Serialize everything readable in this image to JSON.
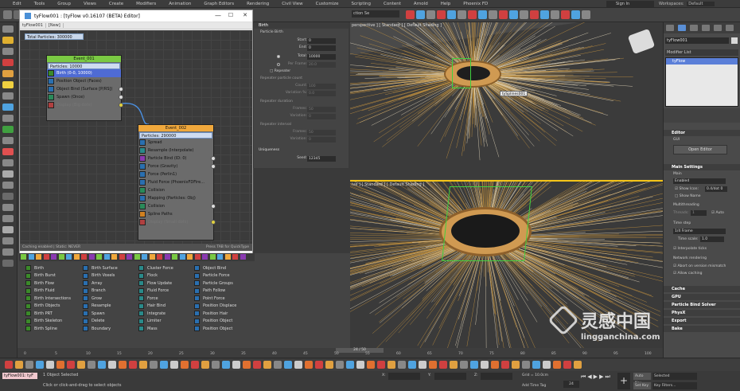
{
  "menu": [
    "Edit",
    "Tools",
    "Group",
    "Views",
    "Create",
    "Modifiers",
    "Animation",
    "Graph Editors",
    "Rendering",
    "Civil View",
    "Customize",
    "Scripting",
    "Content",
    "Arnold",
    "Help",
    "Phoenix FD"
  ],
  "topbar": {
    "sign_in": "Sign In",
    "workspaces_label": "Workspaces:",
    "workspaces_value": "Default",
    "selection_set": "ction Se"
  },
  "viewports": {
    "top_label": "perspective ] [ Standard ] [ Default Shading ]",
    "tooltip": "tySplines001",
    "bottom_label": "ive ] [ Standard ] [ Default Shading ]"
  },
  "editor": {
    "title": "tyFlow001 : [tyFlow v0.16107 (BETA) Editor]",
    "tabs": [
      "tyFlow001",
      "[New]"
    ],
    "total_particles": "Total Particles: 300000",
    "win_minimize": "—",
    "win_maximize": "☐",
    "win_close": "✕",
    "caching": "Caching enabled | Static: NEVER",
    "quicktype_hint": "Press TAB for QuickType",
    "event1": {
      "name": "Event_001",
      "particles": "Particles: 10000",
      "ops": [
        "Birth (0-0, 10000)",
        "Position Object (Faces)",
        "Object Bind (Surface [P/RS])",
        "Spawn (Once)",
        "Display (Big dots)"
      ]
    },
    "event2": {
      "name": "Event_002",
      "particles": "Particles: 290000",
      "ops": [
        "Spread",
        "Resample (Interpolate)",
        "Particle Bind (ID: 0)",
        "Force (Gravity)",
        "Force (Perlin1)",
        "Fluid Force (PhoenixFDFire...",
        "Collision",
        "Mapping (Particles: Obj)",
        "Collision",
        "Spline Paths",
        "Display (Small dots)"
      ]
    }
  },
  "palette": {
    "col1": [
      "Birth",
      "Birth Burst",
      "Birth Flow",
      "Birth Fluid",
      "Birth Intersections",
      "Birth Objects",
      "Birth PRT",
      "Birth Skeleton",
      "Birth Spline"
    ],
    "col2": [
      "Birth Surface",
      "Birth Voxels",
      "Array",
      "Branch",
      "Grow",
      "Resample",
      "Spawn",
      "Delete",
      "Boundary"
    ],
    "col3": [
      "Cluster Force",
      "Flock",
      "Flow Update",
      "Fluid Force",
      "Force",
      "Hair Bind",
      "Integrate",
      "Limiter",
      "Mass"
    ],
    "col4": [
      "Object Bind",
      "Particle Force",
      "Particle Groups",
      "Path Follow",
      "Point Force",
      "Position Displace",
      "Position Hair",
      "Position Object",
      "Position Object"
    ]
  },
  "birth_panel": {
    "header": "Birth",
    "group": "Particle Birth",
    "rows": [
      {
        "label": "Start:",
        "value": "0"
      },
      {
        "label": "End:",
        "value": "0"
      },
      {
        "label": "Total:",
        "value": "10000"
      },
      {
        "label": "Per Frame:",
        "value": "20.0"
      }
    ],
    "repeater_label": "Repeater",
    "sec1": "Repeater particle count",
    "sec1_rows": [
      {
        "label": "Count:",
        "value": "100"
      },
      {
        "label": "Variation %:",
        "value": "0.0"
      }
    ],
    "sec2": "Repeater duration",
    "sec2_rows": [
      {
        "label": "Frames:",
        "value": "50"
      },
      {
        "label": "Variation:",
        "value": "0"
      }
    ],
    "sec3": "Repeater interval",
    "sec3_rows": [
      {
        "label": "Frames:",
        "value": "50"
      },
      {
        "label": "Variation:",
        "value": "0"
      }
    ],
    "uniqueness": "Uniqueness",
    "seed_label": "Seed:",
    "seed_value": "12345"
  },
  "command_panel": {
    "object_name": "tyFlow001",
    "modifier_list": "Modifier List",
    "stack_item": "tyFlow",
    "editor_header": "Editor",
    "gui": "GUI",
    "open_editor": "Open Editor",
    "main_settings": "Main Settings",
    "main": "Main",
    "enabled": "Enabled",
    "show_icon": "Show Icon:",
    "show_icon_value": "0.4/dot 0",
    "show_name": "Show Name",
    "multithreading": "Multithreading",
    "threads": "Threads:",
    "threads_value": "1",
    "auto": "Auto",
    "time_step": "Time step",
    "frame": "1/4 Frame",
    "time_scale": "Time scale:",
    "time_scale_value": "1.0",
    "interpolate": "Interpolate ticks",
    "network": "Network rendering",
    "abort": "Abort on version mismatch",
    "allow_caching": "Allow caching",
    "rollouts": [
      "Cache",
      "GPU",
      "Particle Bind Solver",
      "PhysX",
      "Export",
      "Bake"
    ]
  },
  "timeline": {
    "frame": "24 / 50",
    "ticks": [
      "0",
      "5",
      "10",
      "15",
      "20",
      "25",
      "30",
      "35",
      "40",
      "45",
      "50",
      "55",
      "60",
      "65",
      "70",
      "75",
      "80",
      "85",
      "90",
      "95",
      "100"
    ]
  },
  "status": {
    "maxscript": "tyFlow001:  tyF",
    "selected": "1 Object Selected",
    "hint": "Click or click-and-drag to select objects",
    "x_label": "X:",
    "y_label": "Y:",
    "z_label": "Z:",
    "grid": "Grid = 10.0cm",
    "add_time_tag": "Add Time Tag",
    "auto_key": "Auto Key",
    "set_key": "Set Key",
    "selected_dd": "Selected",
    "key_filters": "Key Filters...",
    "frame_value": "24"
  },
  "watermark": {
    "cn": "灵感中国",
    "en": "lingganchina.com"
  }
}
